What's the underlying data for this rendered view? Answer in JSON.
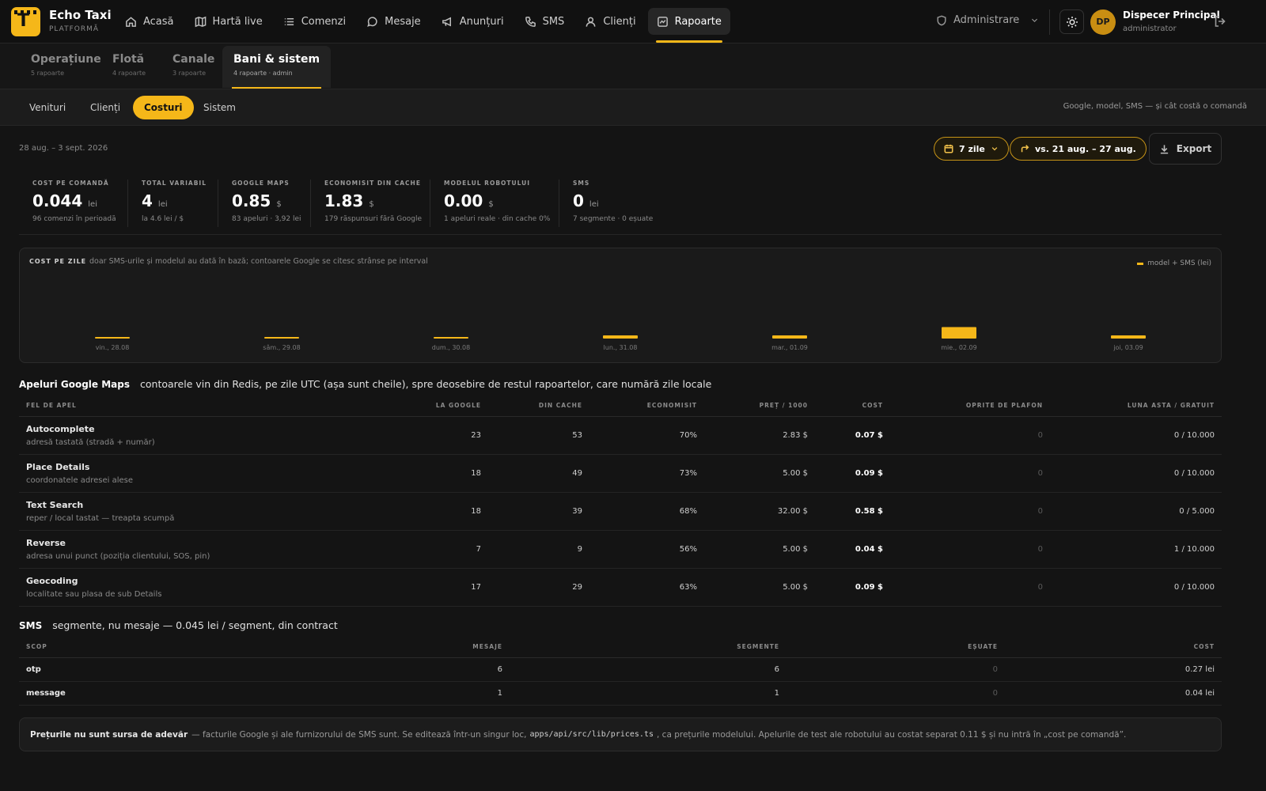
{
  "app": {
    "name": "Echo Taxi",
    "subtitle": "PLATFORMĂ"
  },
  "nav": [
    {
      "label": "Acasă",
      "icon": "home-icon"
    },
    {
      "label": "Hartă live",
      "icon": "map-icon"
    },
    {
      "label": "Comenzi",
      "icon": "list-icon"
    },
    {
      "label": "Mesaje",
      "icon": "chat-icon"
    },
    {
      "label": "Anunțuri",
      "icon": "megaphone-icon"
    },
    {
      "label": "SMS",
      "icon": "phone-icon"
    },
    {
      "label": "Clienți",
      "icon": "user-icon"
    },
    {
      "label": "Rapoarte",
      "icon": "chart-icon",
      "active": true
    }
  ],
  "admin": {
    "label": "Administrare"
  },
  "user": {
    "initials": "DP",
    "name": "Dispecer Principal",
    "role": "administrator"
  },
  "section_tabs": [
    {
      "title": "Operațiune",
      "count": "5 rapoarte"
    },
    {
      "title": "Flotă",
      "count": "4 rapoarte"
    },
    {
      "title": "Canale",
      "count": "3 rapoarte"
    },
    {
      "title": "Bani & sistem",
      "count": "4 rapoarte · admin",
      "active": true
    }
  ],
  "sub_tabs": [
    {
      "label": "Venituri"
    },
    {
      "label": "Clienți"
    },
    {
      "label": "Costuri",
      "active": true
    },
    {
      "label": "Sistem"
    }
  ],
  "sub_hint": "Google, model, SMS — și cât costă o comandă",
  "range": {
    "label": "28 aug. – 3 sept. 2026",
    "period": "7 zile",
    "compare": "vs. 21 aug. – 27 aug.",
    "export": "Export"
  },
  "kpis": [
    {
      "label": "COST PE COMANDĂ",
      "value": "0.044",
      "unit": "lei",
      "sub": "96 comenzi în perioadă"
    },
    {
      "label": "TOTAL VARIABIL",
      "value": "4",
      "unit": "lei",
      "sub": "la 4.6 lei / $"
    },
    {
      "label": "GOOGLE MAPS",
      "value": "0.85",
      "unit": "$",
      "sub": "83 apeluri · 3,92 lei"
    },
    {
      "label": "ECONOMISIT DIN CACHE",
      "value": "1.83",
      "unit": "$",
      "sub": "179 răspunsuri fără Google"
    },
    {
      "label": "MODELUL ROBOTULUI",
      "value": "0.00",
      "unit": "$",
      "sub": "1 apeluri reale · din cache 0%"
    },
    {
      "label": "SMS",
      "value": "0",
      "unit": "lei",
      "sub": "7 segmente · 0 eșuate"
    }
  ],
  "chart_data": {
    "type": "bar",
    "title": "COST PE ZILE",
    "subtitle": "doar SMS-urile și modelul au dată în bază; contoarele Google se citesc strânse pe interval",
    "legend": "model + SMS (lei)",
    "categories": [
      "vin., 28.08",
      "sâm., 29.08",
      "dum., 30.08",
      "lun., 31.08",
      "mar., 01.09",
      "mie., 02.09",
      "joi, 03.09"
    ],
    "series": [
      {
        "name": "model + SMS (lei)",
        "values": [
          0.0,
          0.0,
          0.0,
          0.03,
          0.03,
          0.11,
          0.03
        ]
      }
    ],
    "color": "#f5b719"
  },
  "google": {
    "title": "Apeluri Google Maps",
    "note": "contoarele vin din Redis, pe zile UTC (așa sunt cheile), spre deosebire de restul rapoartelor, care numără zile locale",
    "columns": [
      "FEL DE APEL",
      "LA GOOGLE",
      "DIN CACHE",
      "ECONOMISIT",
      "PREȚ / 1000",
      "COST",
      "OPRITE DE PLAFON",
      "LUNA ASTA / GRATUIT"
    ],
    "rows": [
      {
        "name": "Autocomplete",
        "desc": "adresă tastată (stradă + număr)",
        "google": "23",
        "cache": "53",
        "saved": "70%",
        "price": "2.83 $",
        "cost": "0.07 $",
        "capped": "0",
        "month": "0 / 10.000"
      },
      {
        "name": "Place Details",
        "desc": "coordonatele adresei alese",
        "google": "18",
        "cache": "49",
        "saved": "73%",
        "price": "5.00 $",
        "cost": "0.09 $",
        "capped": "0",
        "month": "0 / 10.000"
      },
      {
        "name": "Text Search",
        "desc": "reper / local tastat — treapta scumpă",
        "google": "18",
        "cache": "39",
        "saved": "68%",
        "price": "32.00 $",
        "cost": "0.58 $",
        "capped": "0",
        "month": "0 / 5.000"
      },
      {
        "name": "Reverse",
        "desc": "adresa unui punct (poziția clientului, SOS, pin)",
        "google": "7",
        "cache": "9",
        "saved": "56%",
        "price": "5.00 $",
        "cost": "0.04 $",
        "capped": "0",
        "month": "1 / 10.000"
      },
      {
        "name": "Geocoding",
        "desc": "localitate sau plasa de sub Details",
        "google": "17",
        "cache": "29",
        "saved": "63%",
        "price": "5.00 $",
        "cost": "0.09 $",
        "capped": "0",
        "month": "0 / 10.000"
      }
    ]
  },
  "sms": {
    "title": "SMS",
    "note": "segmente, nu mesaje — 0.045 lei / segment, din contract",
    "columns": [
      "SCOP",
      "MESAJE",
      "SEGMENTE",
      "EȘUATE",
      "COST"
    ],
    "rows": [
      {
        "scope": "otp",
        "messages": "6",
        "segments": "6",
        "failed": "0",
        "cost": "0.27 lei"
      },
      {
        "scope": "message",
        "messages": "1",
        "segments": "1",
        "failed": "0",
        "cost": "0.04 lei"
      }
    ]
  },
  "footnote": {
    "bold": "Prețurile nu sunt sursa de adevăr",
    "text1": "— facturile Google și ale furnizorului de SMS sunt. Se editează într-un singur loc,",
    "code": "apps/api/src/lib/prices.ts",
    "text2": ", ca prețurile modelului. Apelurile de test ale robotului au costat separat 0.11 $ și nu intră în „cost pe comandă”."
  }
}
